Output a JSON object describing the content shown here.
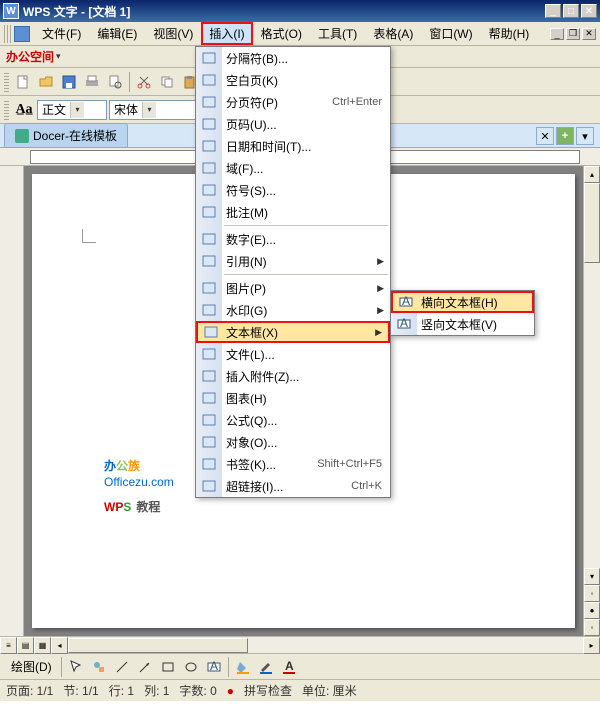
{
  "title": "WPS 文字 - [文档 1]",
  "menubar": [
    "文件(F)",
    "编辑(E)",
    "视图(V)",
    "插入(I)",
    "格式(O)",
    "工具(T)",
    "表格(A)",
    "窗口(W)",
    "帮助(H)"
  ],
  "custom_bar": {
    "prefix": "办公空间",
    "down": "▾"
  },
  "style_combo": "正文",
  "font_combo": "宋体",
  "tab_label": "Docer-在线模板",
  "watermark": {
    "l1": "办公族",
    "l2": "Officezu.com",
    "l3a": "WPS",
    "l3b": "教程"
  },
  "dropdown": [
    {
      "icon": "sep-icon",
      "label": "分隔符(B)...",
      "type": "item"
    },
    {
      "icon": "blank-icon",
      "label": "空白页(K)",
      "type": "item"
    },
    {
      "icon": "pagebreak-icon",
      "label": "分页符(P)",
      "shortcut": "Ctrl+Enter",
      "type": "item"
    },
    {
      "icon": "pagenum-icon",
      "label": "页码(U)...",
      "type": "item"
    },
    {
      "icon": "datetime-icon",
      "label": "日期和时间(T)...",
      "type": "item"
    },
    {
      "icon": "field-icon",
      "label": "域(F)...",
      "type": "item"
    },
    {
      "icon": "symbol-icon",
      "label": "符号(S)...",
      "type": "item"
    },
    {
      "icon": "comment-icon",
      "label": "批注(M)",
      "type": "item"
    },
    {
      "type": "sep"
    },
    {
      "icon": "number-icon",
      "label": "数字(E)...",
      "type": "item"
    },
    {
      "icon": "reference-icon",
      "label": "引用(N)",
      "arrow": true,
      "type": "item"
    },
    {
      "type": "sep"
    },
    {
      "icon": "picture-icon",
      "label": "图片(P)",
      "arrow": true,
      "type": "item"
    },
    {
      "icon": "watermark-icon",
      "label": "水印(G)",
      "arrow": true,
      "type": "item"
    },
    {
      "icon": "textbox-icon",
      "label": "文本框(X)",
      "arrow": true,
      "type": "item",
      "highlighted": true
    },
    {
      "icon": "file-icon",
      "label": "文件(L)...",
      "type": "item"
    },
    {
      "icon": "attachment-icon",
      "label": "插入附件(Z)...",
      "type": "item"
    },
    {
      "icon": "chart-icon",
      "label": "图表(H)",
      "type": "item"
    },
    {
      "icon": "formula-icon",
      "label": "公式(Q)...",
      "type": "item"
    },
    {
      "icon": "object-icon",
      "label": "对象(O)...",
      "type": "item"
    },
    {
      "icon": "bookmark-icon",
      "label": "书签(K)...",
      "shortcut": "Shift+Ctrl+F5",
      "type": "item"
    },
    {
      "icon": "hyperlink-icon",
      "label": "超链接(I)...",
      "shortcut": "Ctrl+K",
      "type": "item"
    }
  ],
  "submenu": [
    {
      "icon": "textbox-h-icon",
      "label": "横向文本框(H)",
      "highlighted": true
    },
    {
      "icon": "textbox-v-icon",
      "label": "竖向文本框(V)"
    }
  ],
  "drawing_label": "绘图(D)",
  "status": {
    "page": "页面: 1/1",
    "section": "节: 1/1",
    "row": "行: 1",
    "col": "列: 1",
    "chars": "字数: 0",
    "spell": "拼写检查",
    "unit": "单位: 厘米"
  }
}
